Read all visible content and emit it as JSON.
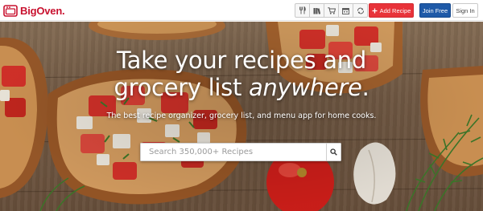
{
  "header": {
    "logo_text": "BigOven.",
    "logo_icon": "bigoven-logo-icon",
    "tools": [
      {
        "name": "recipes-tool-button",
        "icon": "utensils-icon"
      },
      {
        "name": "collections-tool-button",
        "icon": "book-icon"
      },
      {
        "name": "grocery-list-tool-button",
        "icon": "cart-icon"
      },
      {
        "name": "menu-planner-tool-button",
        "icon": "calendar-icon"
      },
      {
        "name": "leftovers-tool-button",
        "icon": "recycle-icon"
      }
    ],
    "add_recipe_label": "Add Recipe",
    "join_free_label": "Join Free",
    "sign_in_label": "Sign In"
  },
  "hero": {
    "headline_line1": "Take your recipes and",
    "headline_line2_prefix": "grocery list ",
    "headline_line2_emphasis": "anywhere",
    "headline_line2_suffix": ".",
    "tagline": "The best recipe organizer, grocery list, and menu app for home cooks.",
    "search_placeholder": "Search 350,000+ Recipes",
    "search_icon": "search-icon"
  },
  "colors": {
    "brand_red": "#c8102e",
    "add_recipe_bg": "#e8333a",
    "join_free_bg": "#1f5aa8"
  }
}
